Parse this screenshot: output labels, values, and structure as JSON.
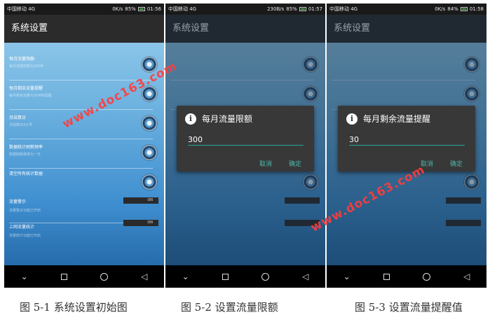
{
  "status": [
    {
      "carrier": "中国移动 4G",
      "speed": "0K/s",
      "battery": "85%",
      "time": "01:56"
    },
    {
      "carrier": "中国移动 4G",
      "speed": "230B/s",
      "battery": "85%",
      "time": "01:57"
    },
    {
      "carrier": "中国移动 4G",
      "speed": "0K/s",
      "battery": "84%",
      "time": "01:58"
    }
  ],
  "app_title": "系统设置",
  "settings": [
    {
      "title": "每月流量限额",
      "subtitle": "每月流量限额为300M"
    },
    {
      "title": "每月剩余流量提醒",
      "subtitle": "每月剩余流量为30M时提醒"
    },
    {
      "title": "月结算日",
      "subtitle": "月结算日为1号"
    },
    {
      "title": "数据统计刷新频率",
      "subtitle": "数据刷新频率为一天"
    },
    {
      "title": "清空所有统计数据",
      "subtitle": ""
    }
  ],
  "toggles": [
    {
      "title": "流量警示",
      "subtitle": "流量警示功能已开启",
      "state": "ON"
    },
    {
      "title": "上网流量统计",
      "subtitle": "流量统计功能已开启",
      "state": "ON"
    }
  ],
  "dialogs": [
    {
      "title": "每月流量限额",
      "value": "300",
      "cancel": "取消",
      "ok": "确定"
    },
    {
      "title": "每月剩余流量提醒",
      "value": "30",
      "cancel": "取消",
      "ok": "确定"
    }
  ],
  "watermark": "www.doc163.com",
  "captions": [
    "图 5-1  系统设置初始图",
    "图 5-2  设置流量限额",
    "图 5-3  设置流量提醒值"
  ],
  "colors": {
    "dialog_bg": "#383838",
    "accent": "#26a69a",
    "watermark": "#ff3c3c"
  }
}
